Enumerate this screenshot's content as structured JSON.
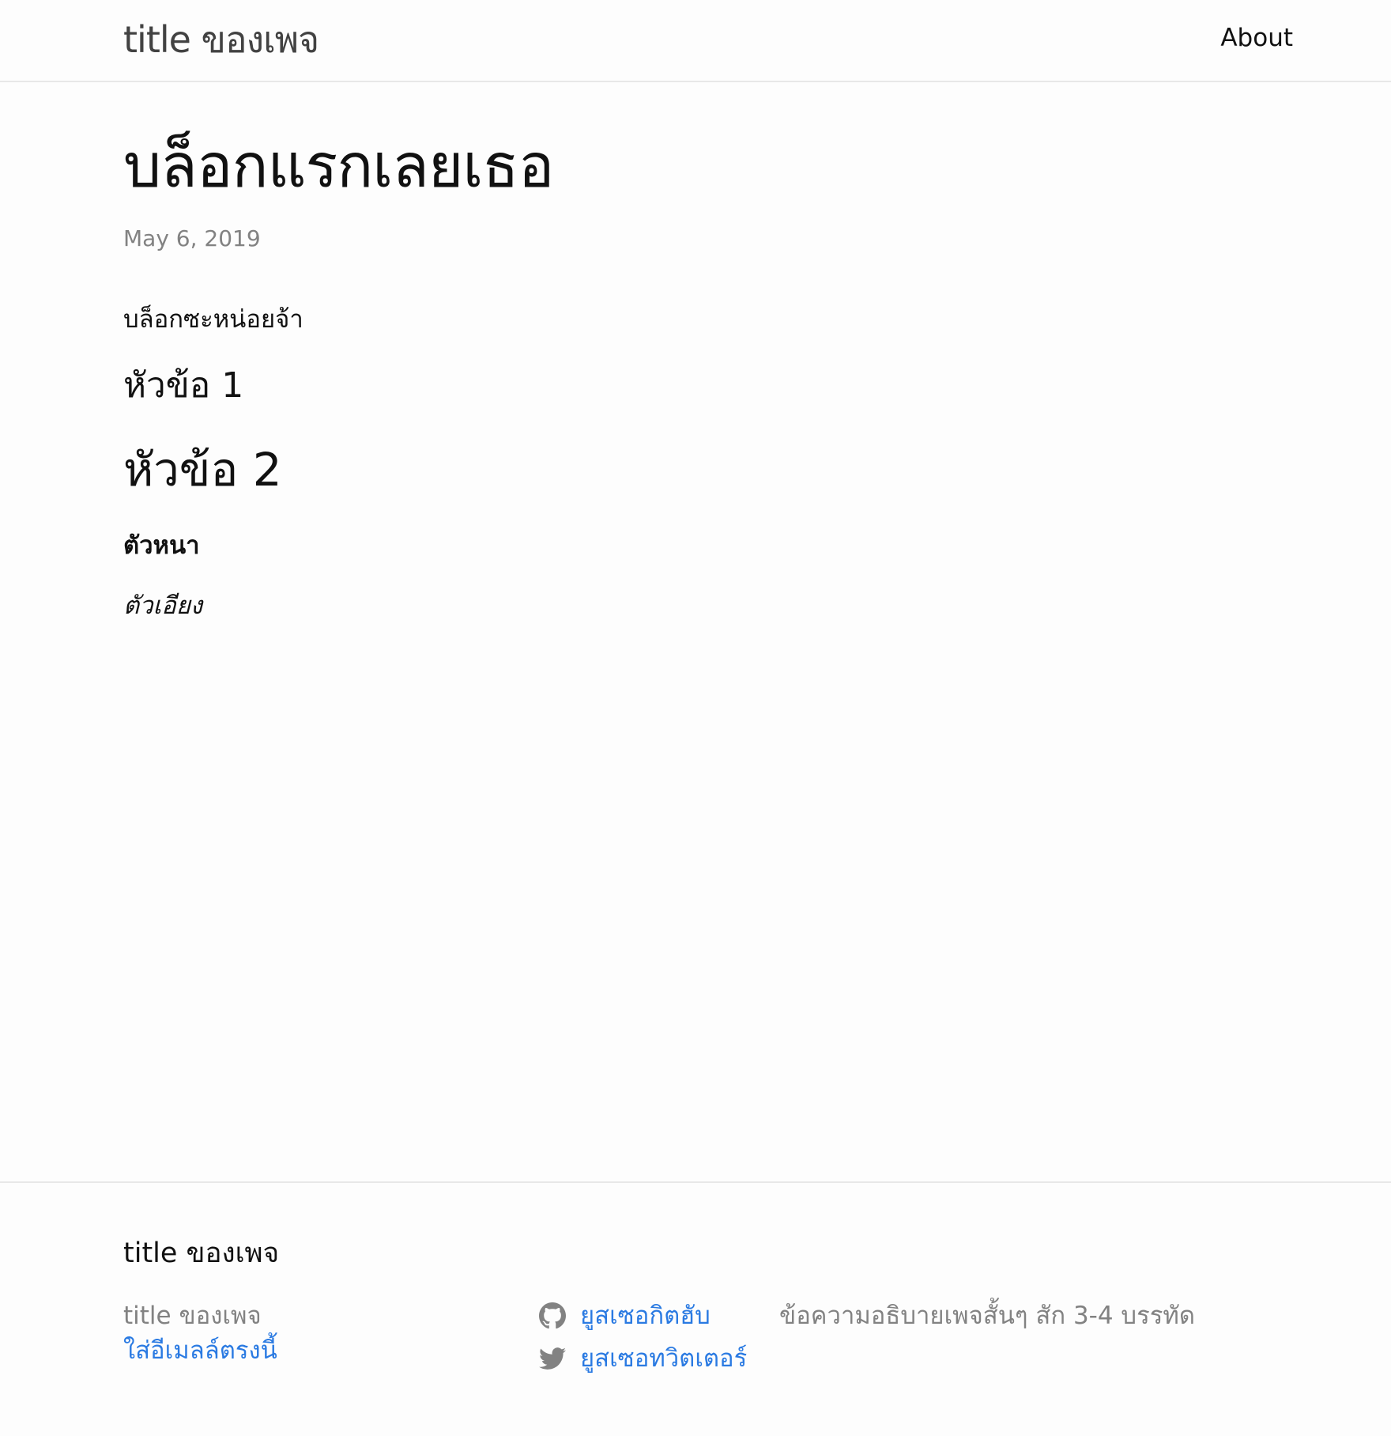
{
  "header": {
    "site_title": "title ของเพจ",
    "nav": [
      {
        "label": "About"
      }
    ]
  },
  "post": {
    "title": "บล็อกแรกเลยเธอ",
    "date": "May 6, 2019",
    "intro": "บล็อกซะหน่อยจ้า",
    "heading_1": "หัวข้อ 1",
    "heading_2": "หัวข้อ 2",
    "bold_text": "ตัวหนา",
    "italic_text": "ตัวเอียง"
  },
  "footer": {
    "heading": "title ของเพจ",
    "name": "title ของเพจ",
    "email": "ใส่อีเมลล์ตรงนี้",
    "social": [
      {
        "icon": "github-icon",
        "label": "ยูสเซอกิตฮับ"
      },
      {
        "icon": "twitter-icon",
        "label": "ยูสเซอทวิตเตอร์"
      }
    ],
    "description": "ข้อความอธิบายเพจสั้นๆ สัก 3-4 บรรทัด"
  },
  "colors": {
    "background": "#fdfdfd",
    "text": "#111111",
    "muted": "#828282",
    "link": "#2a7ae2",
    "border": "#e8e8e8"
  }
}
